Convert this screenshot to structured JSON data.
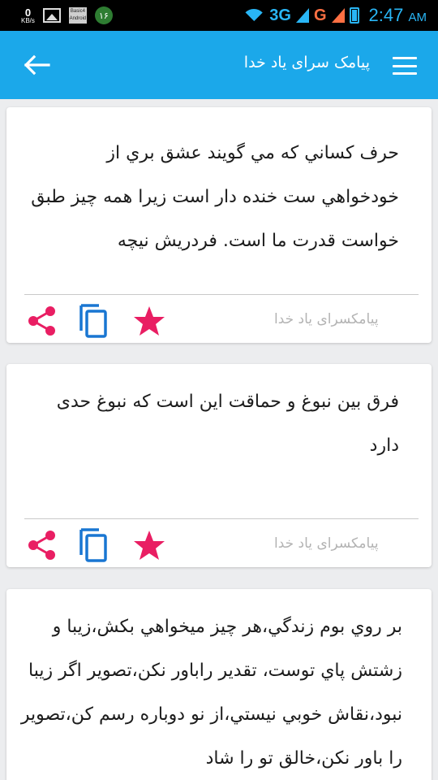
{
  "status_bar": {
    "data_rate": "0",
    "data_unit": "KB/s",
    "basic_label": "Basic4\nAndroid",
    "notification_count": "۱۶",
    "network_1": "3G",
    "network_2": "G",
    "time": "2:47",
    "ampm": "AM"
  },
  "app_bar": {
    "title": "پیامک سرای یاد خدا",
    "back_icon": "arrow-left-icon",
    "menu_icon": "hamburger-menu-icon"
  },
  "colors": {
    "app_bar": "#1ba8ea",
    "share": "#e91e63",
    "copy": "#1976d2",
    "star": "#e91e63"
  },
  "cards": [
    {
      "text": "حرف كساني كه مي گويند عشق بري از خودخواهي ست خنده دار است زيرا همه چيز طبق خواست قدرت ما است. فردريش نيچه",
      "source": "پیامکسرای یاد خدا"
    },
    {
      "text": "فرق بين نبوغ و حماقت اين است كه نبوغ حدی دارد",
      "source": "پیامکسرای یاد خدا"
    },
    {
      "text": "بر روي بوم زندگي،هر چيز ميخواهي بكش،زيبا و زشتش پاي توست، تقدير راباور نكن،تصوير اگر زيبا نبود،نقاش خوبي نيستي،از نو دوباره رسم كن،تصوير را باور نكن،خالق تو را شاد"
    }
  ]
}
